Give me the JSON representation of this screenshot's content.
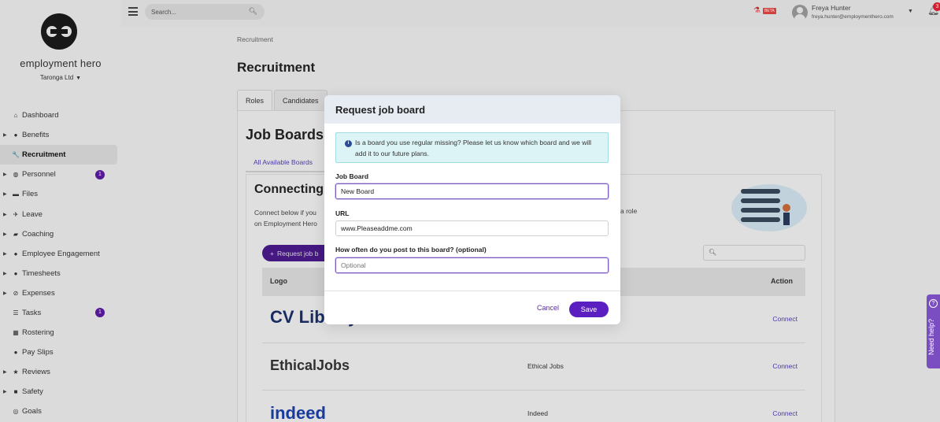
{
  "brand": {
    "name": "employment hero",
    "org": "Taronga Ltd"
  },
  "sidebar": {
    "items": [
      {
        "label": "Dashboard",
        "icon": "home-icon",
        "glyph": "⌂",
        "expandable": false
      },
      {
        "label": "Benefits",
        "icon": "gift-icon",
        "glyph": "●",
        "expandable": true
      },
      {
        "label": "Recruitment",
        "icon": "wrench-icon",
        "glyph": "🔧",
        "expandable": false,
        "active": true
      },
      {
        "label": "Personnel",
        "icon": "globe-icon",
        "glyph": "◍",
        "expandable": true,
        "badge": "1"
      },
      {
        "label": "Files",
        "icon": "folder-icon",
        "glyph": "▬",
        "expandable": true
      },
      {
        "label": "Leave",
        "icon": "plane-icon",
        "glyph": "✈",
        "expandable": true
      },
      {
        "label": "Coaching",
        "icon": "chat-icon",
        "glyph": "▰",
        "expandable": true
      },
      {
        "label": "Employee Engagement",
        "icon": "heart-icon",
        "glyph": "●",
        "expandable": true
      },
      {
        "label": "Timesheets",
        "icon": "clock-icon",
        "glyph": "●",
        "expandable": true
      },
      {
        "label": "Expenses",
        "icon": "no-entry-icon",
        "glyph": "⊘",
        "expandable": true
      },
      {
        "label": "Tasks",
        "icon": "list-icon",
        "glyph": "☰",
        "expandable": false,
        "badge": "1"
      },
      {
        "label": "Rostering",
        "icon": "calendar-icon",
        "glyph": "▦",
        "expandable": false
      },
      {
        "label": "Pay Slips",
        "icon": "money-icon",
        "glyph": "●",
        "expandable": false
      },
      {
        "label": "Reviews",
        "icon": "star-icon",
        "glyph": "★",
        "expandable": true
      },
      {
        "label": "Safety",
        "icon": "shield-icon",
        "glyph": "■",
        "expandable": true
      },
      {
        "label": "Goals",
        "icon": "target-icon",
        "glyph": "◎",
        "expandable": false
      }
    ]
  },
  "header": {
    "search_placeholder": "Search...",
    "beta_label": "BETA",
    "user_name": "Freya Hunter",
    "user_email": "freya.hunter@employmenthero.com",
    "notifications_count": "3"
  },
  "main": {
    "breadcrumb": "Recruitment",
    "title": "Recruitment",
    "tabs": [
      "Roles",
      "Candidates"
    ],
    "section_title": "Job Boards",
    "subtab": "All Available Boards",
    "connecting_title": "Connecting",
    "connect_text": "Connect below if you",
    "connect_text_2": "on Employment Hero",
    "connect_text_right": "a role",
    "request_button": "Request job b",
    "table": {
      "col_logo": "Logo",
      "col_action": "Action",
      "rows": [
        {
          "logo": "CV Library",
          "name": "",
          "action": "Connect"
        },
        {
          "logo": "EthicalJobs",
          "name": "Ethical Jobs",
          "action": "Connect"
        },
        {
          "logo": "indeed",
          "name": "Indeed",
          "action": "Connect"
        }
      ]
    }
  },
  "modal": {
    "title": "Request job board",
    "info": "Is a board you use regular missing? Please let us know which board and we will add it to our future plans.",
    "fields": {
      "job_board_label": "Job Board",
      "job_board_value": "New Board",
      "url_label": "URL",
      "url_value": "www.Pleaseaddme.com",
      "frequency_label": "How often do you post to this board? (optional)",
      "frequency_placeholder": "Optional"
    },
    "cancel": "Cancel",
    "save": "Save"
  },
  "help": {
    "label": "Need help?"
  },
  "colors": {
    "accent": "#5b1ec0",
    "info_bg": "#dcf4f6",
    "modal_header": "#e7ebf2"
  }
}
